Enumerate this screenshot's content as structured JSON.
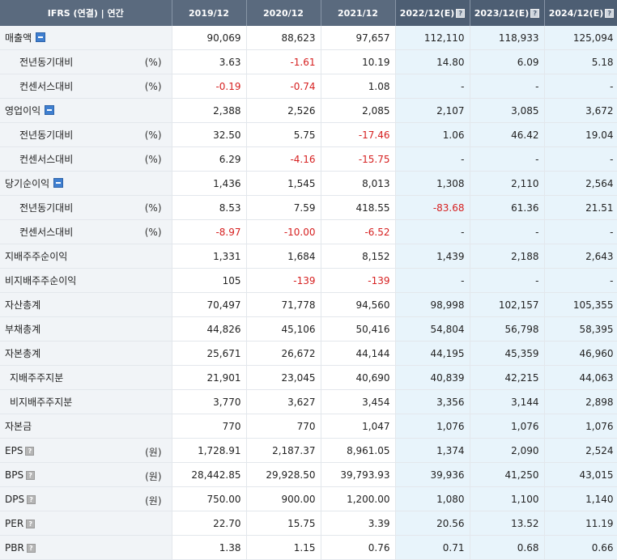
{
  "header": {
    "label": "IFRS (연결) | 연간",
    "years": [
      "2019/12",
      "2020/12",
      "2021/12",
      "2022/12(E)",
      "2023/12(E)",
      "2024/12(E)"
    ],
    "estimate_flags": [
      false,
      false,
      false,
      true,
      true,
      true
    ]
  },
  "rows": [
    {
      "label": "매출액",
      "unit": "",
      "level": 0,
      "toggle": true,
      "help": false,
      "values": [
        "90,069",
        "88,623",
        "97,657",
        "112,110",
        "118,933",
        "125,094"
      ]
    },
    {
      "label": "전년동기대비",
      "unit": "(%)",
      "level": 1,
      "toggle": false,
      "help": false,
      "values": [
        "3.63",
        "-1.61",
        "10.19",
        "14.80",
        "6.09",
        "5.18"
      ]
    },
    {
      "label": "컨센서스대비",
      "unit": "(%)",
      "level": 1,
      "toggle": false,
      "help": false,
      "values": [
        "-0.19",
        "-0.74",
        "1.08",
        "-",
        "-",
        "-"
      ]
    },
    {
      "label": "영업이익",
      "unit": "",
      "level": 0,
      "toggle": true,
      "help": false,
      "values": [
        "2,388",
        "2,526",
        "2,085",
        "2,107",
        "3,085",
        "3,672"
      ]
    },
    {
      "label": "전년동기대비",
      "unit": "(%)",
      "level": 1,
      "toggle": false,
      "help": false,
      "values": [
        "32.50",
        "5.75",
        "-17.46",
        "1.06",
        "46.42",
        "19.04"
      ]
    },
    {
      "label": "컨센서스대비",
      "unit": "(%)",
      "level": 1,
      "toggle": false,
      "help": false,
      "values": [
        "6.29",
        "-4.16",
        "-15.75",
        "-",
        "-",
        "-"
      ]
    },
    {
      "label": "당기순이익",
      "unit": "",
      "level": 0,
      "toggle": true,
      "help": false,
      "values": [
        "1,436",
        "1,545",
        "8,013",
        "1,308",
        "2,110",
        "2,564"
      ]
    },
    {
      "label": "전년동기대비",
      "unit": "(%)",
      "level": 1,
      "toggle": false,
      "help": false,
      "values": [
        "8.53",
        "7.59",
        "418.55",
        "-83.68",
        "61.36",
        "21.51"
      ]
    },
    {
      "label": "컨센서스대비",
      "unit": "(%)",
      "level": 1,
      "toggle": false,
      "help": false,
      "values": [
        "-8.97",
        "-10.00",
        "-6.52",
        "-",
        "-",
        "-"
      ]
    },
    {
      "label": "지배주주순이익",
      "unit": "",
      "level": 0,
      "toggle": false,
      "help": false,
      "values": [
        "1,331",
        "1,684",
        "8,152",
        "1,439",
        "2,188",
        "2,643"
      ]
    },
    {
      "label": "비지배주주순이익",
      "unit": "",
      "level": 0,
      "toggle": false,
      "help": false,
      "values": [
        "105",
        "-139",
        "-139",
        "-",
        "-",
        "-"
      ]
    },
    {
      "label": "자산총계",
      "unit": "",
      "level": 0,
      "toggle": false,
      "help": false,
      "values": [
        "70,497",
        "71,778",
        "94,560",
        "98,998",
        "102,157",
        "105,355"
      ]
    },
    {
      "label": "부채총계",
      "unit": "",
      "level": 0,
      "toggle": false,
      "help": false,
      "values": [
        "44,826",
        "45,106",
        "50,416",
        "54,804",
        "56,798",
        "58,395"
      ]
    },
    {
      "label": "자본총계",
      "unit": "",
      "level": 0,
      "toggle": false,
      "help": false,
      "values": [
        "25,671",
        "26,672",
        "44,144",
        "44,195",
        "45,359",
        "46,960"
      ]
    },
    {
      "label": "지배주주지분",
      "unit": "",
      "level": 2,
      "toggle": false,
      "help": false,
      "values": [
        "21,901",
        "23,045",
        "40,690",
        "40,839",
        "42,215",
        "44,063"
      ]
    },
    {
      "label": "비지배주주지분",
      "unit": "",
      "level": 2,
      "toggle": false,
      "help": false,
      "values": [
        "3,770",
        "3,627",
        "3,454",
        "3,356",
        "3,144",
        "2,898"
      ]
    },
    {
      "label": "자본금",
      "unit": "",
      "level": 0,
      "toggle": false,
      "help": false,
      "values": [
        "770",
        "770",
        "1,047",
        "1,076",
        "1,076",
        "1,076"
      ]
    },
    {
      "label": "EPS",
      "unit": "(원)",
      "level": 0,
      "toggle": false,
      "help": true,
      "values": [
        "1,728.91",
        "2,187.37",
        "8,961.05",
        "1,374",
        "2,090",
        "2,524"
      ]
    },
    {
      "label": "BPS",
      "unit": "(원)",
      "level": 0,
      "toggle": false,
      "help": true,
      "values": [
        "28,442.85",
        "29,928.50",
        "39,793.93",
        "39,936",
        "41,250",
        "43,015"
      ]
    },
    {
      "label": "DPS",
      "unit": "(원)",
      "level": 0,
      "toggle": false,
      "help": true,
      "values": [
        "750.00",
        "900.00",
        "1,200.00",
        "1,080",
        "1,100",
        "1,140"
      ]
    },
    {
      "label": "PER",
      "unit": "",
      "level": 0,
      "toggle": false,
      "help": true,
      "values": [
        "22.70",
        "15.75",
        "3.39",
        "20.56",
        "13.52",
        "11.19"
      ]
    },
    {
      "label": "PBR",
      "unit": "",
      "level": 0,
      "toggle": false,
      "help": true,
      "values": [
        "1.38",
        "1.15",
        "0.76",
        "0.71",
        "0.68",
        "0.66"
      ]
    }
  ],
  "colors": {
    "header_bg": "#5a6a7e",
    "label_bg": "#f1f4f7",
    "estimate_bg": "#e8f4fb",
    "negative": "#d62020"
  },
  "icons": {
    "toggle": "collapse-minus-icon",
    "help": "help-question-icon"
  }
}
